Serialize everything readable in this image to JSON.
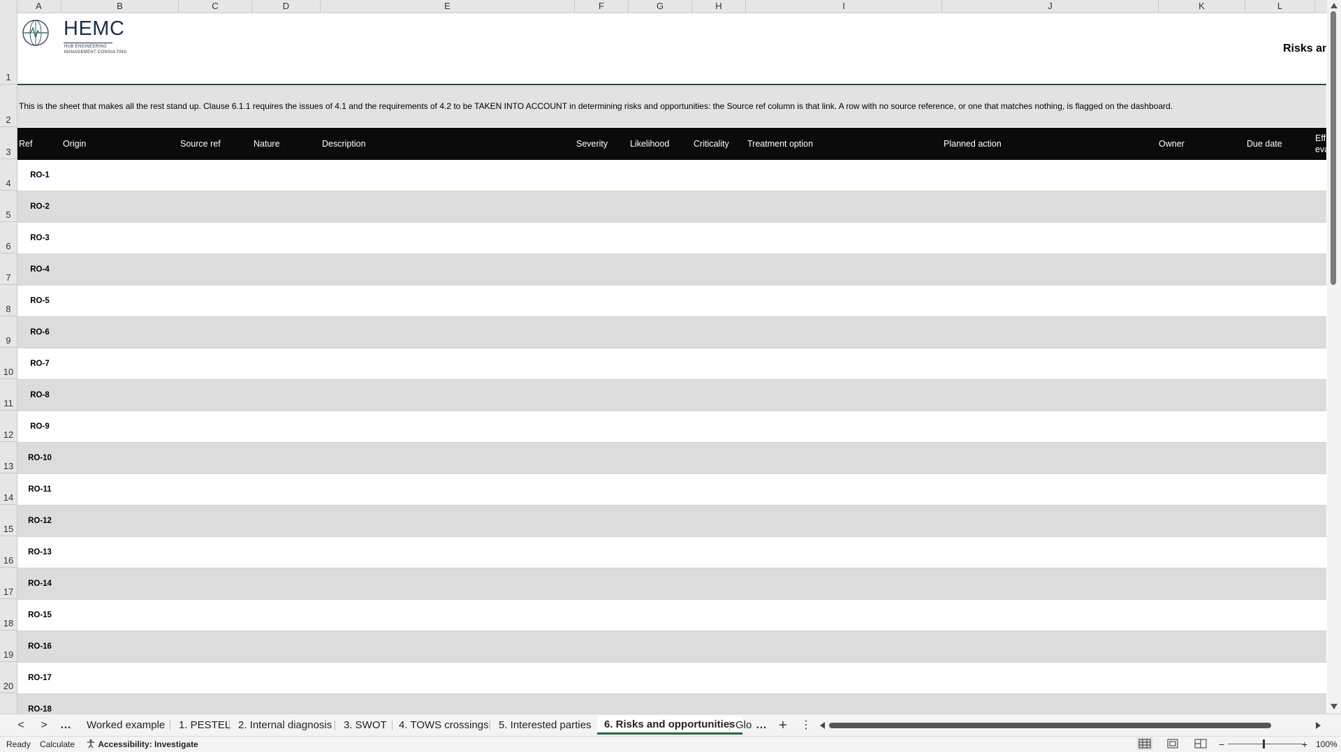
{
  "columns": [
    "A",
    "B",
    "C",
    "D",
    "E",
    "F",
    "G",
    "H",
    "I",
    "J",
    "K",
    "L"
  ],
  "rows_visible": [
    "1",
    "2",
    "3",
    "4",
    "5",
    "6",
    "7",
    "8",
    "9",
    "10",
    "11",
    "12",
    "13",
    "14",
    "15",
    "16",
    "17",
    "18",
    "19",
    "20"
  ],
  "logo": {
    "name": "HEMC",
    "line1": "HUB ENGINEERING",
    "line2": "MANAGEMENT CONSULTING"
  },
  "sheet_title": "Risks and",
  "intro": "This is the sheet that makes all the rest stand up. Clause 6.1.1 requires the issues of 4.1 and the requirements of 4.2 to be TAKEN INTO ACCOUNT in determining risks and opportunities: the Source ref column is that link. A row with no source reference, or one that matches nothing, is flagged on the dashboard.",
  "table_headers": {
    "ref": "Ref",
    "origin": "Origin",
    "source_ref": "Source ref",
    "nature": "Nature",
    "description": "Description",
    "severity": "Severity",
    "likelihood": "Likelihood",
    "criticality": "Criticality",
    "treatment_option": "Treatment option",
    "planned_action": "Planned action",
    "owner": "Owner",
    "due_date": "Due date",
    "effectiveness_line1": "Eff",
    "effectiveness_line2": "eva"
  },
  "refs": [
    "RO-1",
    "RO-2",
    "RO-3",
    "RO-4",
    "RO-5",
    "RO-6",
    "RO-7",
    "RO-8",
    "RO-9",
    "RO-10",
    "RO-11",
    "RO-12",
    "RO-13",
    "RO-14",
    "RO-15",
    "RO-16",
    "RO-17",
    "RO-18"
  ],
  "tabs": {
    "nav_prev": "<",
    "nav_next": ">",
    "more_left": "…",
    "items": [
      "Worked example",
      "1. PESTEL",
      "2. Internal diagnosis",
      "3. SWOT",
      "4. TOWS crossings",
      "5. Interested parties",
      "6. Risks and opportunities",
      "Glo"
    ],
    "active": "6. Risks and opportunities",
    "more_right": "…",
    "add": "+",
    "options": "⋮"
  },
  "status": {
    "ready": "Ready",
    "calculate": "Calculate",
    "accessibility": "Accessibility: Investigate",
    "zoom_minus": "−",
    "zoom_plus": "+",
    "zoom": "100%"
  },
  "colors": {
    "header_bg": "#0b0b0b",
    "alt_row": "#dcdcdc",
    "active_tab_underline": "#1e6b3c",
    "logo": "#1b2d4a"
  }
}
